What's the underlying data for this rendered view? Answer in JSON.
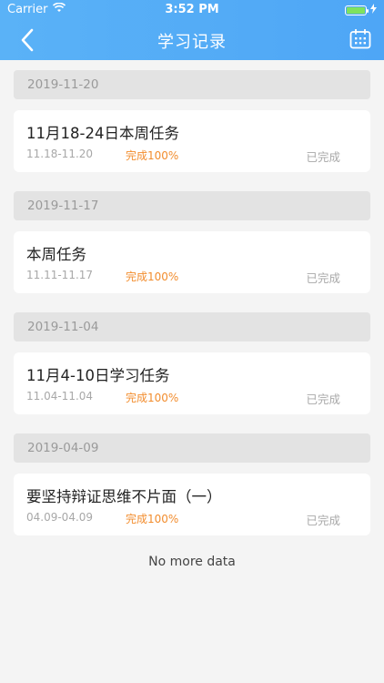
{
  "status": {
    "carrier": "Carrier",
    "time": "3:52 PM"
  },
  "nav": {
    "title": "学习记录",
    "back_icon": "chevron-left-icon",
    "calendar_icon": "calendar-icon"
  },
  "records": [
    {
      "date": "2019-11-20",
      "title": "11月18-24日本周任务",
      "range": "11.18-11.20",
      "progress": "完成100%",
      "status": "已完成"
    },
    {
      "date": "2019-11-17",
      "title": "本周任务",
      "range": "11.11-11.17",
      "progress": "完成100%",
      "status": "已完成"
    },
    {
      "date": "2019-11-04",
      "title": "11月4-10日学习任务",
      "range": "11.04-11.04",
      "progress": "完成100%",
      "status": "已完成"
    },
    {
      "date": "2019-04-09",
      "title": "要坚持辩证思维不片面（一）",
      "range": "04.09-04.09",
      "progress": "完成100%",
      "status": "已完成"
    }
  ],
  "footer": {
    "no_more": "No more data"
  },
  "colors": {
    "header": "#4ea6f6",
    "progress": "#f28d2e",
    "muted": "#a8a8a8"
  }
}
